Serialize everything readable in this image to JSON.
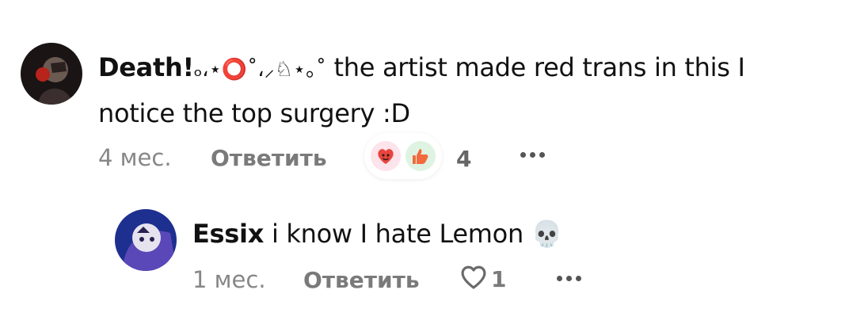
{
  "comments": [
    {
      "author": "Death!",
      "author_decoration": "ₒ،⋆⭕˚،⸝♘⋆｡˚",
      "text_line1": "the artist made red trans in this I",
      "text_line2": "notice the top surgery :D",
      "time": "4 мес.",
      "reply_label": "Ответить",
      "reactions": [
        "heart-face-icon",
        "thumbs-up-icon"
      ],
      "reaction_count": "4"
    }
  ],
  "replies": [
    {
      "author": "Essix",
      "text": "i know I hate Lemon 💀",
      "time": "1 мес.",
      "reply_label": "Ответить",
      "like_count": "1"
    }
  ],
  "colors": {
    "meta_gray": "#878787",
    "heart_bg": "#fde3ea",
    "thumb_bg": "#dff3e2",
    "accent_red": "#e8453c"
  }
}
